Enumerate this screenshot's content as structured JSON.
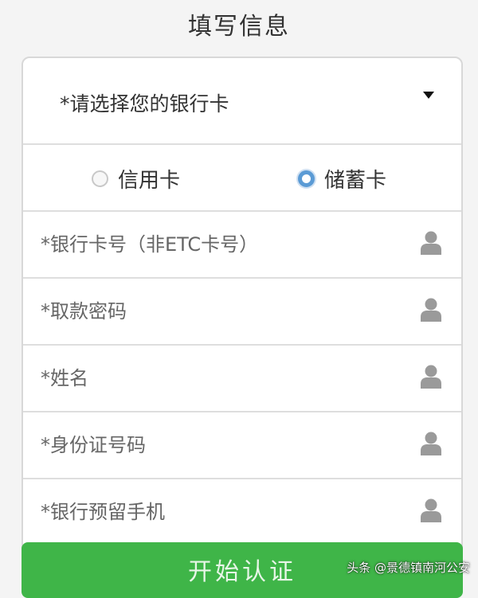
{
  "header": {
    "title": "填写信息"
  },
  "bank_select": {
    "label": "*请选择您的银行卡"
  },
  "card_type": {
    "options": [
      {
        "label": "信用卡",
        "checked": false
      },
      {
        "label": "储蓄卡",
        "checked": true
      }
    ]
  },
  "fields": [
    {
      "placeholder": "*银行卡号（非ETC卡号）",
      "value": "",
      "icon": "person-icon"
    },
    {
      "placeholder": "*取款密码",
      "value": "",
      "icon": "person-icon"
    },
    {
      "placeholder": "*姓名",
      "value": "",
      "icon": "person-icon"
    },
    {
      "placeholder": "*身份证号码",
      "value": "",
      "icon": "person-icon"
    },
    {
      "placeholder": "*银行预留手机",
      "value": "",
      "icon": "person-icon"
    }
  ],
  "submit": {
    "label": "开始认证"
  },
  "watermark": {
    "text": "头条 @景德镇南河公安"
  },
  "colors": {
    "accent": "#3fb548",
    "radio_checked": "#5b9bd5",
    "icon_gray": "#9a9a9a",
    "border": "#d8d8d8"
  }
}
